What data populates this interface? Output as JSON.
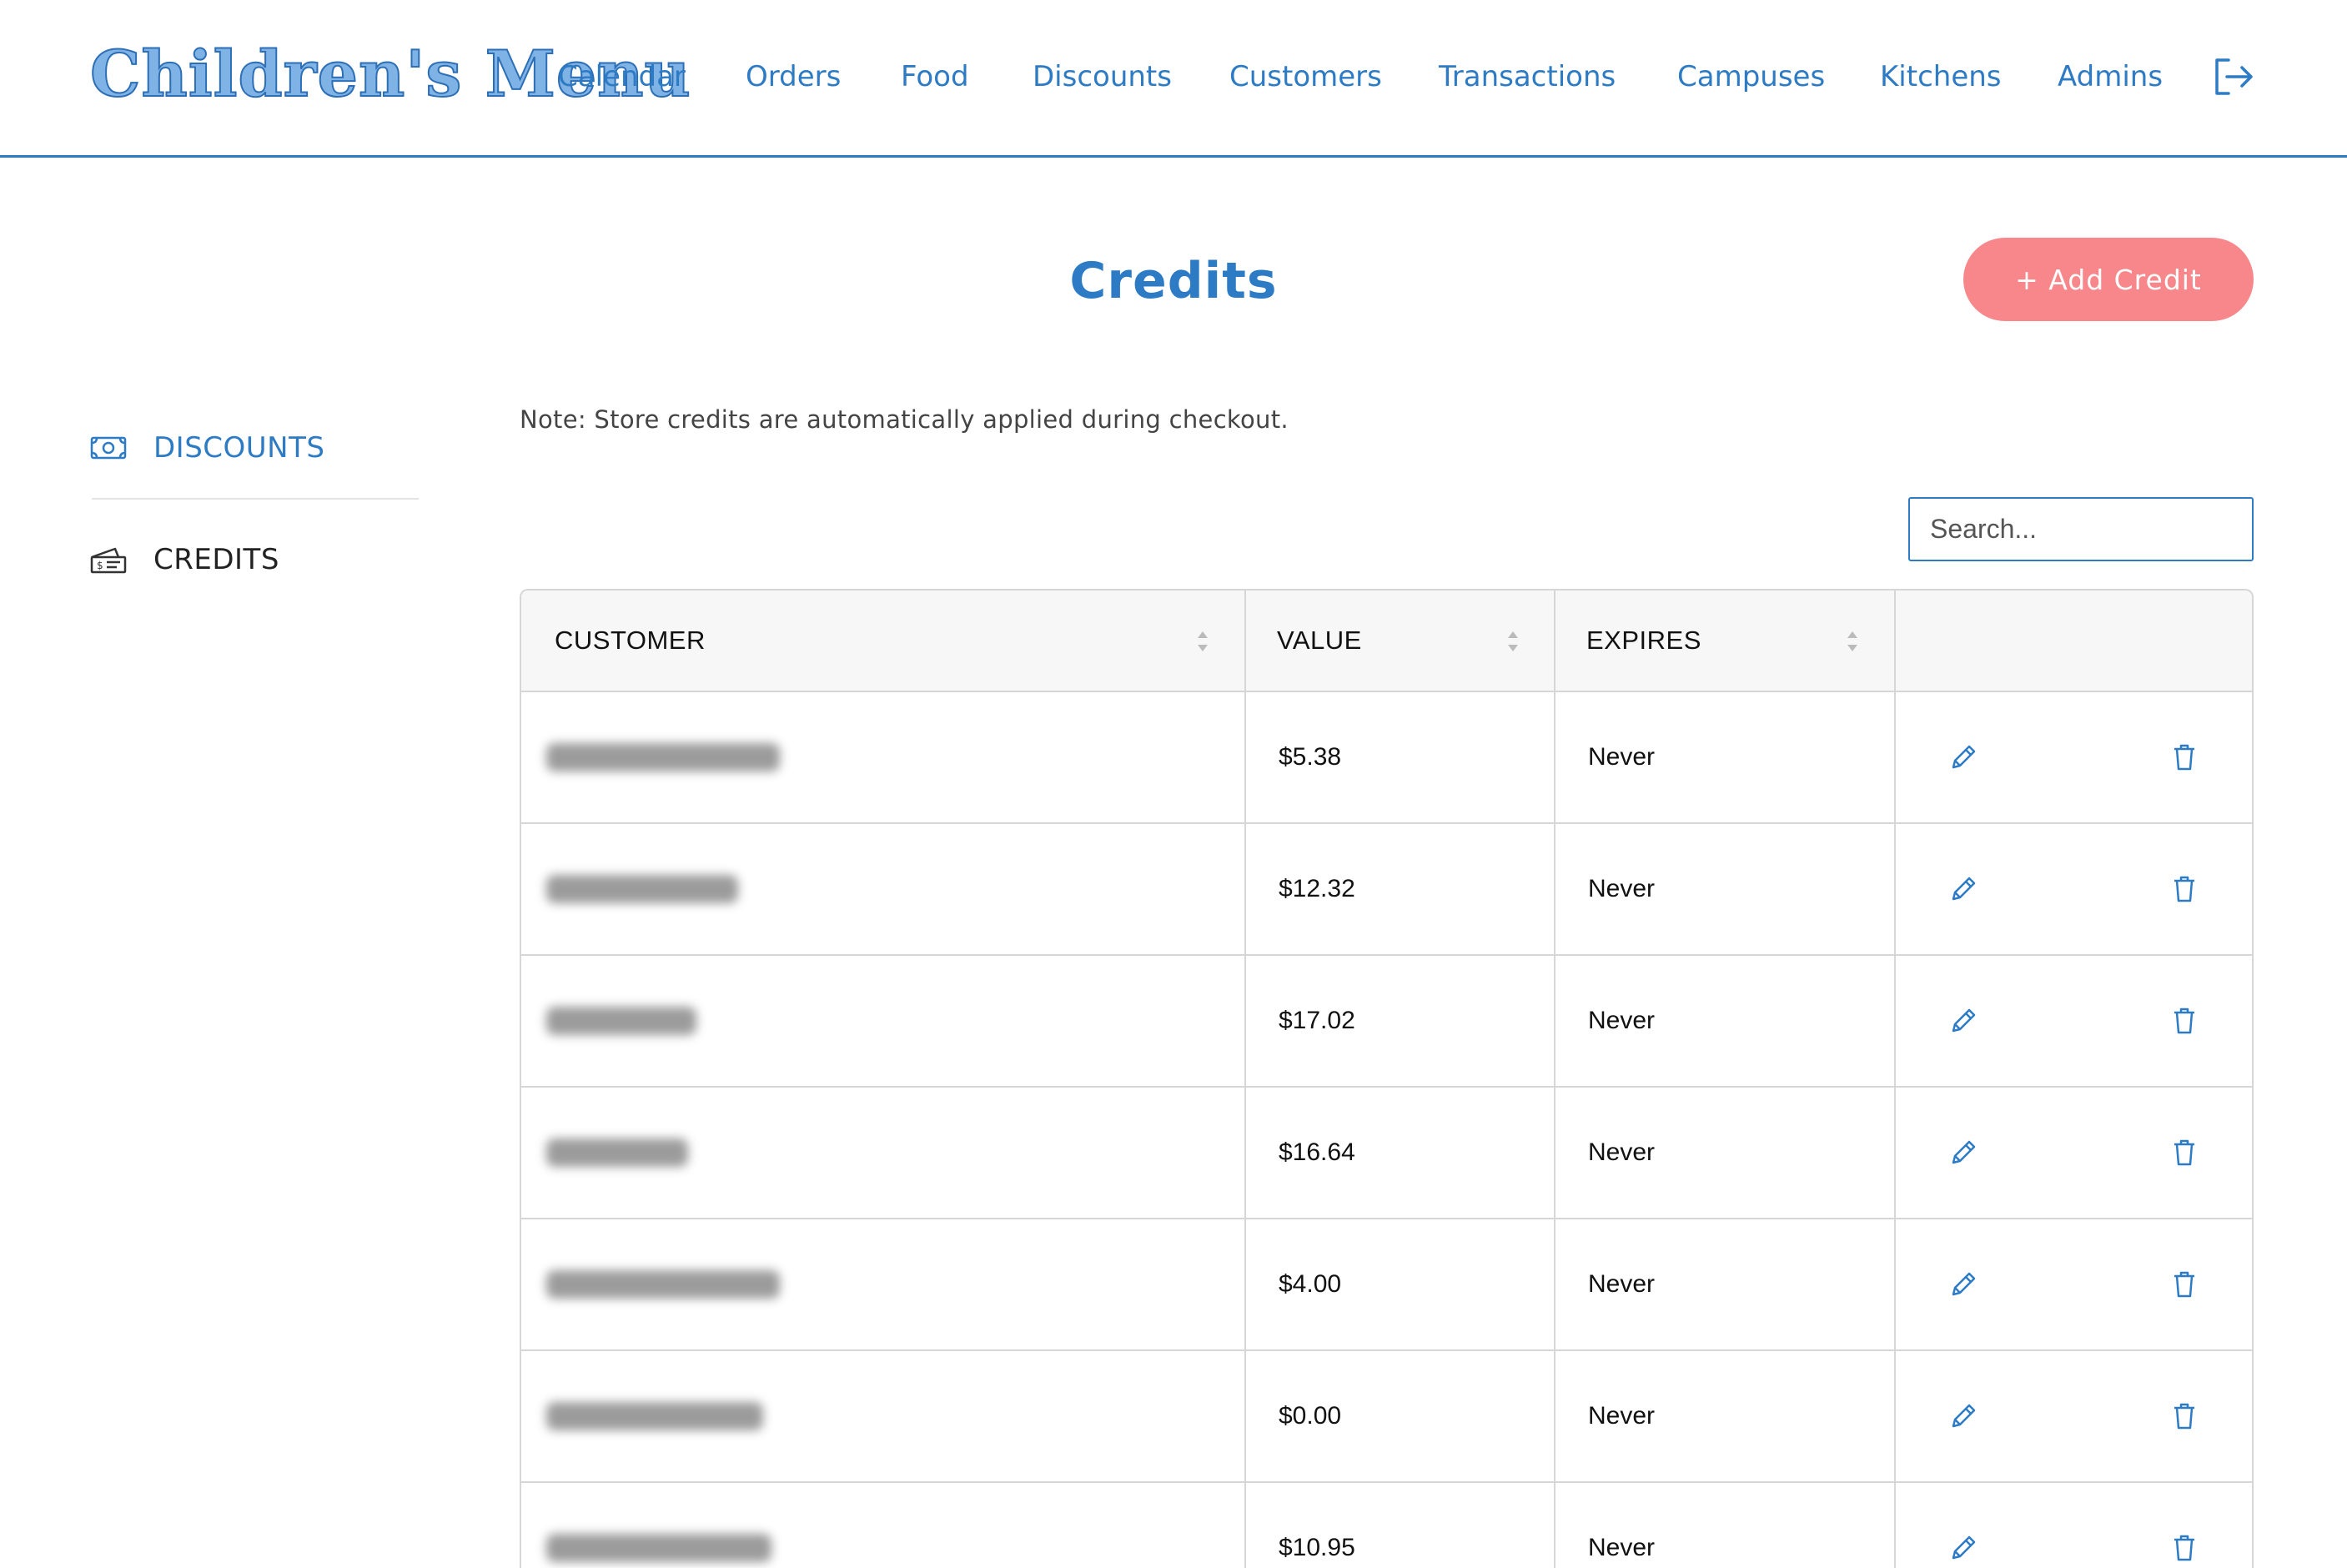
{
  "header": {
    "logo_text": "Children's Menu",
    "nav": [
      "Calendar",
      "Orders",
      "Food",
      "Discounts",
      "Customers",
      "Transactions",
      "Campuses",
      "Kitchens",
      "Admins"
    ],
    "logout_icon": "logout-icon"
  },
  "page": {
    "title": "Credits",
    "add_button_label": "+ Add Credit",
    "note": "Note: Store credits are automatically applied during checkout."
  },
  "sidebar": {
    "items": [
      {
        "label": "DISCOUNTS",
        "icon": "money-bill-icon",
        "active": true
      },
      {
        "label": "CREDITS",
        "icon": "credit-ticket-icon",
        "active": false
      }
    ]
  },
  "search": {
    "placeholder": "Search...",
    "value": ""
  },
  "table": {
    "columns": [
      "CUSTOMER",
      "VALUE",
      "EXPIRES"
    ],
    "rows": [
      {
        "customer": "",
        "value": "$5.38",
        "expires": "Never"
      },
      {
        "customer": "",
        "value": "$12.32",
        "expires": "Never"
      },
      {
        "customer": "",
        "value": "$17.02",
        "expires": "Never"
      },
      {
        "customer": "",
        "value": "$16.64",
        "expires": "Never"
      },
      {
        "customer": "",
        "value": "$4.00",
        "expires": "Never"
      },
      {
        "customer": "",
        "value": "$0.00",
        "expires": "Never"
      },
      {
        "customer": "",
        "value": "$10.95",
        "expires": "Never"
      }
    ]
  },
  "colors": {
    "brand_blue": "#2d7bc4",
    "add_button": "#f7878a",
    "border": "#d6d6d6",
    "header_bg": "#f7f7f7"
  }
}
